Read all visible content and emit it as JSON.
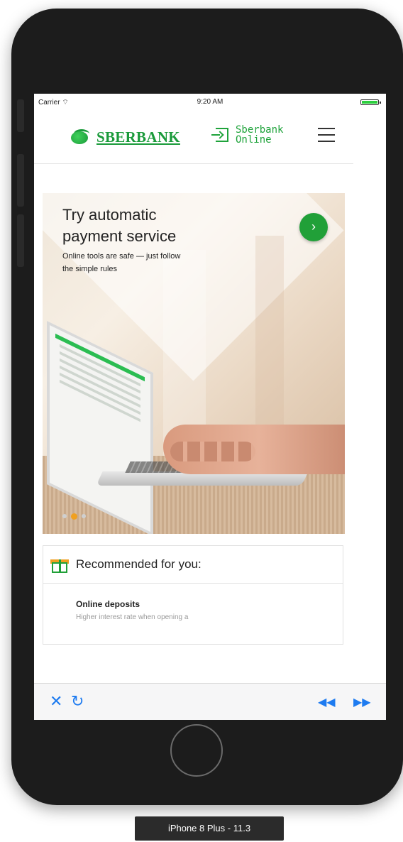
{
  "status_bar": {
    "carrier": "Carrier",
    "wifi_icon": "wifi-icon",
    "time": "9:20 AM",
    "battery_icon": "battery-icon"
  },
  "header": {
    "logo_text": "SBERBANK",
    "online_label_line1": "Sberbank",
    "online_label_line2": "Online",
    "menu_icon": "hamburger-icon",
    "brand_color": "#21a038"
  },
  "promo": {
    "title": "Try automatic payment service",
    "subtitle": "Online tools are safe — just follow the simple rules",
    "next_symbol": "›",
    "active_dot_color": "#f0a020"
  },
  "recommended": {
    "title": "Recommended for you:",
    "item_title": "Online deposits",
    "item_desc": "Higher interest rate when opening a"
  },
  "toolbar": {
    "close_symbol": "✕",
    "reload_symbol": "↻",
    "back_symbol": "◀◀",
    "forward_symbol": "▶▶",
    "accent_color": "#1e7bf0"
  },
  "device": {
    "label": "iPhone 8 Plus - 11.3"
  }
}
